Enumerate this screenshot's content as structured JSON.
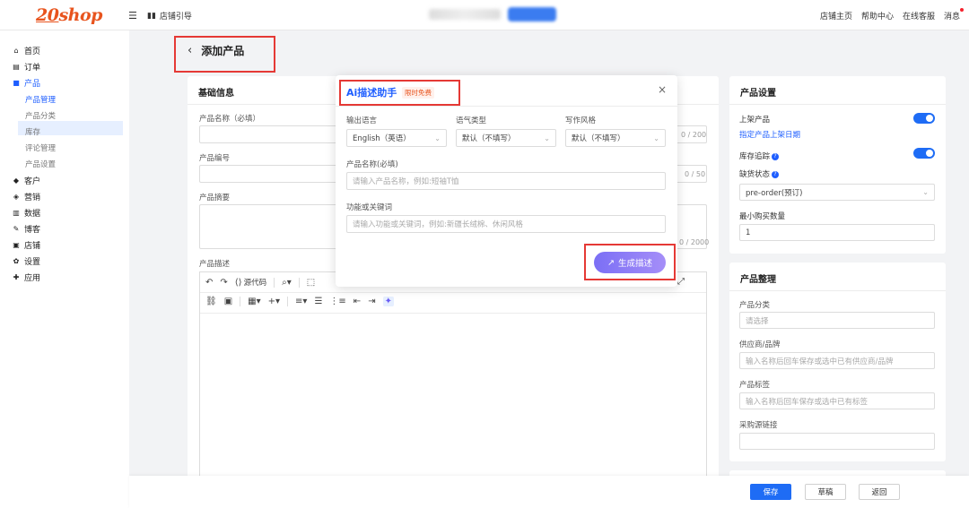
{
  "topbar": {
    "logo_num": "20",
    "logo_text": "shop",
    "menu_icon": "menu-icon",
    "store_guide": "店铺引导",
    "nav": [
      "店铺主页",
      "帮助中心",
      "在线客服",
      "消息"
    ]
  },
  "sidebar": {
    "items": [
      {
        "icon": "home-icon",
        "label": "首页"
      },
      {
        "icon": "order-icon",
        "label": "订单"
      },
      {
        "icon": "bag-icon",
        "label": "产品"
      },
      {
        "icon": "customer-icon",
        "label": "客户"
      },
      {
        "icon": "tag-icon",
        "label": "营销"
      },
      {
        "icon": "chart-icon",
        "label": "数据"
      },
      {
        "icon": "blog-icon",
        "label": "博客"
      },
      {
        "icon": "store-icon",
        "label": "店铺"
      },
      {
        "icon": "gear-icon",
        "label": "设置"
      },
      {
        "icon": "puzzle-icon",
        "label": "应用"
      }
    ],
    "sub_items": [
      "产品管理",
      "产品分类",
      "库存",
      "评论管理",
      "产品设置"
    ]
  },
  "page": {
    "title": "添加产品"
  },
  "basic_info": {
    "title": "基础信息",
    "name_label": "产品名称（必填）",
    "name_counter": "0 / 200",
    "code_label": "产品编号",
    "code_counter": "0 / 50",
    "summary_label": "产品摘要",
    "summary_counter": "0 / 2000",
    "desc_label": "产品描述",
    "source_code": "源代码"
  },
  "product_settings": {
    "title": "产品设置",
    "listing_label": "上架产品",
    "listing_date_link": "指定产品上架日期",
    "inventory_label": "库存追踪",
    "stockout_label": "缺货状态",
    "stockout_value": "pre-order(预订)",
    "min_qty_label": "最小购买数量",
    "min_qty_value": "1"
  },
  "product_org": {
    "title": "产品整理",
    "category_label": "产品分类",
    "category_placeholder": "请选择",
    "vendor_label": "供应商/品牌",
    "vendor_placeholder": "输入名称后回车保存或选中已有供应商/品牌",
    "tags_label": "产品标签",
    "tags_placeholder": "输入名称后回车保存或选中已有标签",
    "purchase_link_label": "采购源链接"
  },
  "footer": {
    "save": "保存",
    "draft": "草稿",
    "back": "返回"
  },
  "ai_modal": {
    "title": "Ai描述助手",
    "tag": "限时免费",
    "lang_label": "输出语言",
    "lang_value": "English（英语）",
    "tone_label": "语气类型",
    "tone_value": "默认（不填写）",
    "style_label": "写作风格",
    "style_value": "默认（不填写）",
    "name_label": "产品名称(必填)",
    "name_placeholder": "请输入产品名称，例如:短袖T恤",
    "keywords_label": "功能或关键词",
    "keywords_placeholder": "请输入功能或关键词，例如:新疆长绒棉、休闲风格",
    "generate": "生成描述"
  },
  "colors": {
    "primary": "#1e6cf5",
    "brand": "#e8541e",
    "highlight": "#e53935",
    "ai_gradient_start": "#7b6ff5"
  }
}
